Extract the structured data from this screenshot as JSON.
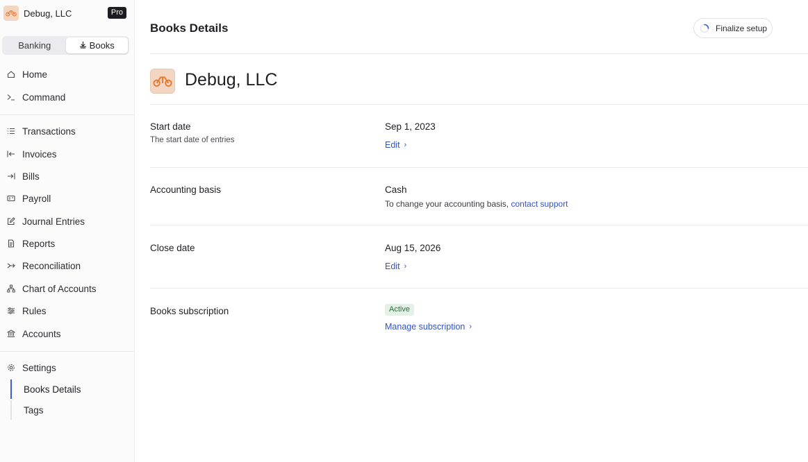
{
  "org": {
    "name": "Debug, LLC",
    "badge": "Pro",
    "logo_icon": "company-logo-icon"
  },
  "switcher": {
    "banking": "Banking",
    "books": "Books",
    "books_icon": "books-icon"
  },
  "nav": {
    "home": "Home",
    "command": "Command",
    "transactions": "Transactions",
    "invoices": "Invoices",
    "bills": "Bills",
    "payroll": "Payroll",
    "journal_entries": "Journal Entries",
    "reports": "Reports",
    "reconciliation": "Reconciliation",
    "chart_of_accounts": "Chart of Accounts",
    "rules": "Rules",
    "accounts": "Accounts",
    "settings": "Settings",
    "books_details": "Books Details",
    "tags": "Tags"
  },
  "header": {
    "title": "Books Details",
    "finalize": "Finalize setup"
  },
  "company": {
    "name": "Debug, LLC"
  },
  "details": {
    "start_date": {
      "label": "Start date",
      "desc": "The start date of entries",
      "value": "Sep 1, 2023",
      "action": "Edit"
    },
    "accounting_basis": {
      "label": "Accounting basis",
      "value": "Cash",
      "note": "To change your accounting basis,",
      "link": "contact support"
    },
    "close_date": {
      "label": "Close date",
      "value": "Aug 15, 2026",
      "action": "Edit"
    },
    "subscription": {
      "label": "Books subscription",
      "status": "Active",
      "action": "Manage subscription"
    }
  },
  "colors": {
    "accent": "#3152c7",
    "active_nav": "#3d5bd6",
    "badge_bg": "#e3f1e7",
    "logo_bg": "#f3d6c2",
    "logo_fg": "#e8792f"
  }
}
